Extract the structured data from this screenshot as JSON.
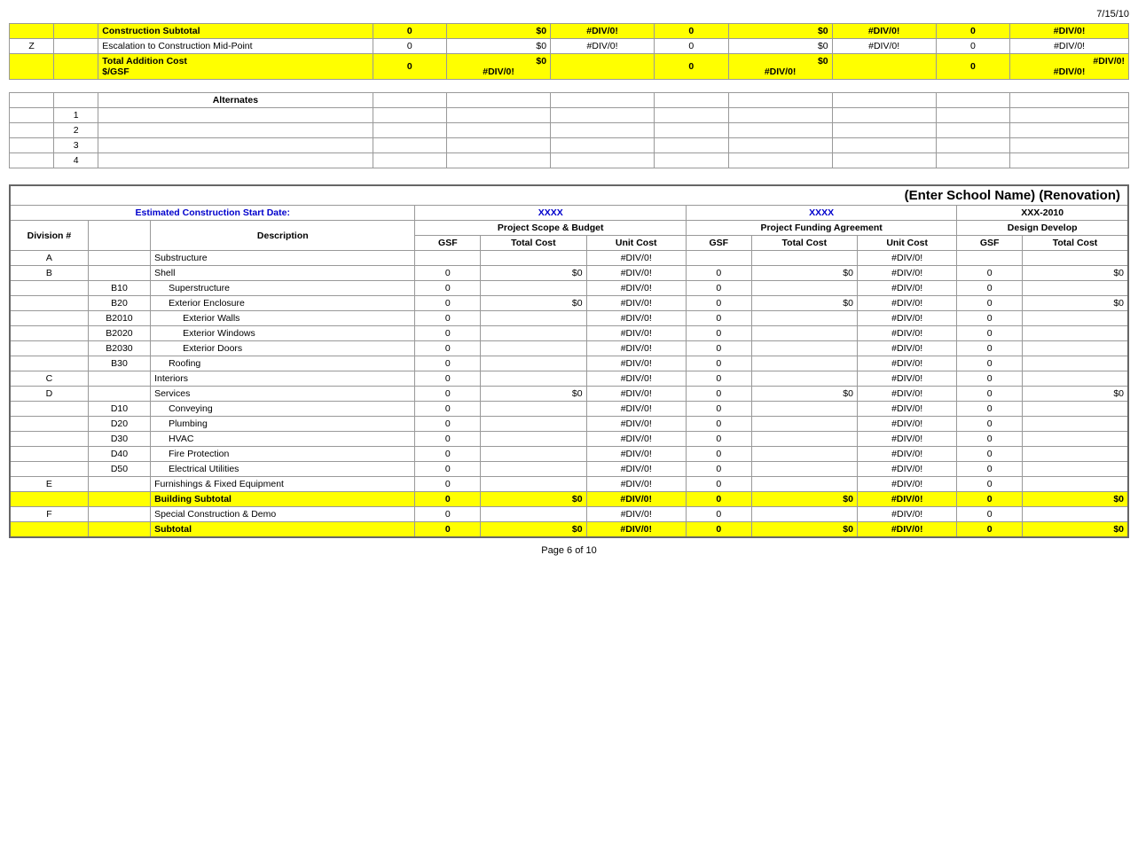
{
  "date": "7/15/10",
  "top_section": {
    "construction_subtotal": {
      "label": "Construction Subtotal",
      "gsf1": "0",
      "total1": "$0",
      "unit1": "#DIV/0!",
      "gsf2": "0",
      "total2": "$0",
      "unit2": "#DIV/0!",
      "gsf3": "0",
      "unit3": "#DIV/0!"
    },
    "escalation": {
      "prefix": "Z",
      "label": "Escalation to Construction Mid-Point",
      "gsf1": "0",
      "total1": "$0",
      "unit1": "#DIV/0!",
      "gsf2": "0",
      "total2": "$0",
      "unit2": "#DIV/0!",
      "gsf3": "0",
      "unit3": "#DIV/0!"
    },
    "total_addition": {
      "label": "Total Addition Cost",
      "gsf_label": "$/GSF",
      "gsf1": "0",
      "total1": "$0",
      "unit1": "#DIV/0!",
      "gsf2": "0",
      "total2": "$0",
      "gsf_unit2": "#DIV/0!",
      "gsf3": "0",
      "unit3": "#DIV/0!",
      "gsf_unit3": "#DIV/0!"
    }
  },
  "alternates": {
    "title": "Alternates",
    "items": [
      "1",
      "2",
      "3",
      "4"
    ]
  },
  "renovation_section": {
    "title": "(Enter School Name) (Renovation)",
    "start_date_label": "Estimated Construction Start Date:",
    "col1_ref": "XXXX",
    "col2_ref": "XXXX",
    "col3_ref": "XXX-2010",
    "col1_header": "Project Scope & Budget",
    "col2_header": "Project Funding Agreement",
    "col3_header": "Design Develop",
    "sub_headers": {
      "gsf": "GSF",
      "total_cost": "Total Cost",
      "unit_cost": "Unit Cost"
    },
    "rows": [
      {
        "div": "A",
        "sub": "",
        "indent": 0,
        "label": "Substructure",
        "gsf1": "",
        "total1": "",
        "unit1": "#DIV/0!",
        "gsf2": "",
        "total2": "",
        "unit2": "#DIV/0!",
        "gsf3": "",
        "total3": ""
      },
      {
        "div": "B",
        "sub": "",
        "indent": 0,
        "label": "Shell",
        "gsf1": "0",
        "total1": "$0",
        "unit1": "#DIV/0!",
        "gsf2": "0",
        "total2": "$0",
        "unit2": "#DIV/0!",
        "gsf3": "0",
        "total3": "$0"
      },
      {
        "div": "",
        "sub": "B10",
        "indent": 1,
        "label": "Superstructure",
        "gsf1": "0",
        "total1": "",
        "unit1": "#DIV/0!",
        "gsf2": "0",
        "total2": "",
        "unit2": "#DIV/0!",
        "gsf3": "0",
        "total3": ""
      },
      {
        "div": "",
        "sub": "B20",
        "indent": 1,
        "label": "Exterior Enclosure",
        "gsf1": "0",
        "total1": "$0",
        "unit1": "#DIV/0!",
        "gsf2": "0",
        "total2": "$0",
        "unit2": "#DIV/0!",
        "gsf3": "0",
        "total3": "$0"
      },
      {
        "div": "",
        "sub": "B2010",
        "indent": 2,
        "label": "Exterior Walls",
        "gsf1": "0",
        "total1": "",
        "unit1": "#DIV/0!",
        "gsf2": "0",
        "total2": "",
        "unit2": "#DIV/0!",
        "gsf3": "0",
        "total3": ""
      },
      {
        "div": "",
        "sub": "B2020",
        "indent": 2,
        "label": "Exterior Windows",
        "gsf1": "0",
        "total1": "",
        "unit1": "#DIV/0!",
        "gsf2": "0",
        "total2": "",
        "unit2": "#DIV/0!",
        "gsf3": "0",
        "total3": ""
      },
      {
        "div": "",
        "sub": "B2030",
        "indent": 2,
        "label": "Exterior Doors",
        "gsf1": "0",
        "total1": "",
        "unit1": "#DIV/0!",
        "gsf2": "0",
        "total2": "",
        "unit2": "#DIV/0!",
        "gsf3": "0",
        "total3": ""
      },
      {
        "div": "",
        "sub": "B30",
        "indent": 1,
        "label": "Roofing",
        "gsf1": "0",
        "total1": "",
        "unit1": "#DIV/0!",
        "gsf2": "0",
        "total2": "",
        "unit2": "#DIV/0!",
        "gsf3": "0",
        "total3": ""
      },
      {
        "div": "C",
        "sub": "",
        "indent": 0,
        "label": "Interiors",
        "gsf1": "0",
        "total1": "",
        "unit1": "#DIV/0!",
        "gsf2": "0",
        "total2": "",
        "unit2": "#DIV/0!",
        "gsf3": "0",
        "total3": ""
      },
      {
        "div": "D",
        "sub": "",
        "indent": 0,
        "label": "Services",
        "gsf1": "0",
        "total1": "$0",
        "unit1": "#DIV/0!",
        "gsf2": "0",
        "total2": "$0",
        "unit2": "#DIV/0!",
        "gsf3": "0",
        "total3": "$0"
      },
      {
        "div": "",
        "sub": "D10",
        "indent": 1,
        "label": "Conveying",
        "gsf1": "0",
        "total1": "",
        "unit1": "#DIV/0!",
        "gsf2": "0",
        "total2": "",
        "unit2": "#DIV/0!",
        "gsf3": "0",
        "total3": ""
      },
      {
        "div": "",
        "sub": "D20",
        "indent": 1,
        "label": "Plumbing",
        "gsf1": "0",
        "total1": "",
        "unit1": "#DIV/0!",
        "gsf2": "0",
        "total2": "",
        "unit2": "#DIV/0!",
        "gsf3": "0",
        "total3": ""
      },
      {
        "div": "",
        "sub": "D30",
        "indent": 1,
        "label": "HVAC",
        "gsf1": "0",
        "total1": "",
        "unit1": "#DIV/0!",
        "gsf2": "0",
        "total2": "",
        "unit2": "#DIV/0!",
        "gsf3": "0",
        "total3": ""
      },
      {
        "div": "",
        "sub": "D40",
        "indent": 1,
        "label": "Fire Protection",
        "gsf1": "0",
        "total1": "",
        "unit1": "#DIV/0!",
        "gsf2": "0",
        "total2": "",
        "unit2": "#DIV/0!",
        "gsf3": "0",
        "total3": ""
      },
      {
        "div": "",
        "sub": "D50",
        "indent": 1,
        "label": "Electrical Utilities",
        "gsf1": "0",
        "total1": "",
        "unit1": "#DIV/0!",
        "gsf2": "0",
        "total2": "",
        "unit2": "#DIV/0!",
        "gsf3": "0",
        "total3": ""
      },
      {
        "div": "E",
        "sub": "",
        "indent": 0,
        "label": "Furnishings & Fixed Equipment",
        "gsf1": "0",
        "total1": "",
        "unit1": "#DIV/0!",
        "gsf2": "0",
        "total2": "",
        "unit2": "#DIV/0!",
        "gsf3": "0",
        "total3": ""
      }
    ],
    "building_subtotal": {
      "label": "Building Subtotal",
      "gsf1": "0",
      "total1": "$0",
      "unit1": "#DIV/0!",
      "gsf2": "0",
      "total2": "$0",
      "unit2": "#DIV/0!",
      "gsf3": "0",
      "total3": "$0"
    },
    "special_construction": {
      "div": "F",
      "label": "Special Construction & Demo",
      "gsf1": "0",
      "total1": "",
      "unit1": "#DIV/0!",
      "gsf2": "0",
      "total2": "",
      "unit2": "#DIV/0!",
      "gsf3": "0",
      "total3": ""
    },
    "subtotal": {
      "label": "Subtotal",
      "gsf1": "0",
      "total1": "$0",
      "unit1": "#DIV/0!",
      "gsf2": "0",
      "total2": "$0",
      "unit2": "#DIV/0!",
      "gsf3": "0",
      "total3": "$0"
    }
  },
  "footer": {
    "page_label": "Page 6 of 10"
  }
}
